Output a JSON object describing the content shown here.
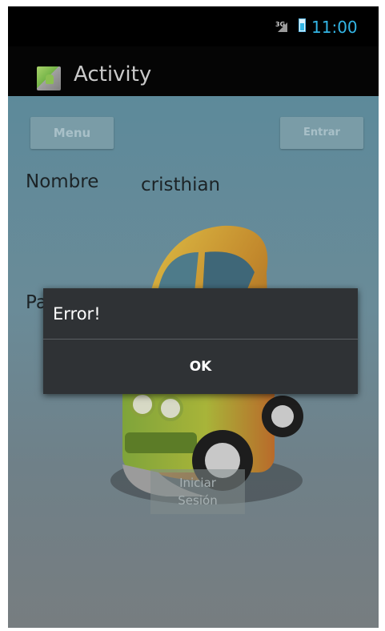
{
  "status_bar": {
    "network_label": "3G",
    "time": "11:00",
    "signal_icon": "signal-icon",
    "battery_icon": "battery-icon"
  },
  "action_bar": {
    "title": "Activity",
    "app_icon": "app-icon"
  },
  "buttons": {
    "menu": "Menu",
    "entrar": "Entrar",
    "login_line1": "Iniciar",
    "login_line2": "Sesión"
  },
  "form": {
    "name_label": "Nombre",
    "name_value": "cristhian",
    "password_label_partial": "Pa"
  },
  "dialog": {
    "title": "Error!",
    "ok_label": "OK"
  },
  "colors": {
    "accent": "#33b5e5",
    "dialog_bg": "#2f3235",
    "dim_overlay": "#5d8a9a"
  }
}
